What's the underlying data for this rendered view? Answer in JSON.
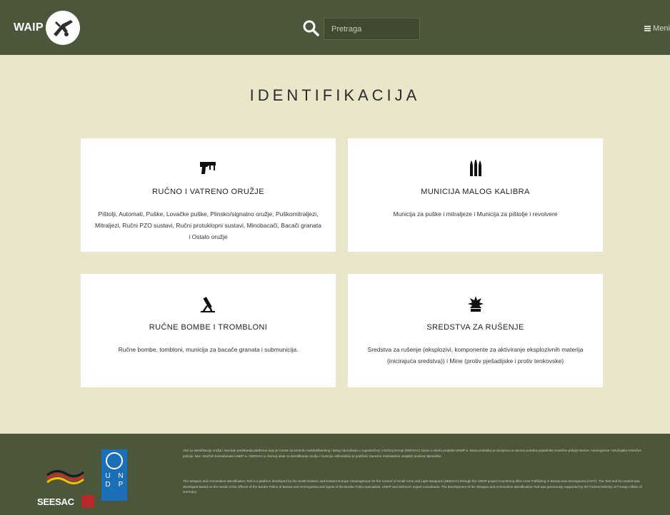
{
  "header": {
    "brand": "WAIP",
    "search_placeholder": "Pretraga",
    "menu_label": "Meni"
  },
  "page": {
    "title": "IDENTIFIKACIJA"
  },
  "cards": [
    {
      "title": "RUČNO I VATRENO ORUŽJE",
      "description": "Pištolji, Automati, Puške, Lovačke puške, Plinsko/signalno oružje, Puškomitraljezi, Mitraljezi, Ručni PZO sustavi, Ručni protuklopni sustavi, Minobacači, Bacači granata i Ostalo oružje",
      "icon": "pistol-icon"
    },
    {
      "title": "MUNICIJA MALOG KALIBRA",
      "description": "Municija za puške i mitraljeze i Municija za pištolje i revolvere",
      "icon": "ammunition-icon"
    },
    {
      "title": "RUČNE BOMBE I TROMBLONI",
      "description": "Ručne bombe, tombloni, municija za bacače granata i submunicija.",
      "icon": "mortar-icon"
    },
    {
      "title": "SREDSTVA ZA RUŠENJE",
      "description": "Sredstva za rušenje (eksplozivi, komponente za aktiviranje eksplozivnih materija (inicirajuća sredstva)) i Mine (protiv pješadijske i protiv tenkovske)",
      "icon": "explosion-icon"
    }
  ],
  "footer": {
    "seesac_label": "SEESAC",
    "undp_letters": [
      "U",
      "N",
      "D",
      "P"
    ],
    "text_local": "Alat za identifikaciju oružja i municije predstavlja platformu koju je Centar za kontrolu malokalibarskog i lakog naoružanja u Jugoistočnoj i Istočnoj Evropi (SEESAC) razvio u okviru projekta UNDP-a. Baza podataka je razvijena na osnovu potreba pripadnika Granične policije Bosne i Hercegovine i stručnjaka Granične policije, kao i stručnih konsultanata UNDP-a i SEESAC-a. Razvoj alata za identifikaciju oružja i municije velikodušno je podržalo Savezno ministarstvo vanjskih poslova Njemačke.",
    "text_en": "The Weapon and Ammunition Identification Tool is a platform developed by the South Eastern and Eastern Europe Clearinghouse for the Control of Small Arms and Light Weapons (SEESAC) through the UNDP project Countering Illicit Arms Trafficking in Bosnia and Herzegovina (CIAT). The Tool and its content was developed based on the needs of the officers of the Border Police of Bosnia and Herzegovina and inputs of the Border Police specialists, UNDP and SEESAC expert consultants. The development of the Weapon and Ammunition Identification Tool was generously supported by the Federal Ministry of Foreign Affairs of Germany."
  },
  "colors": {
    "header_bg": "#4b563a",
    "page_bg": "#e9e6c9",
    "card_bg": "#ffffff"
  }
}
